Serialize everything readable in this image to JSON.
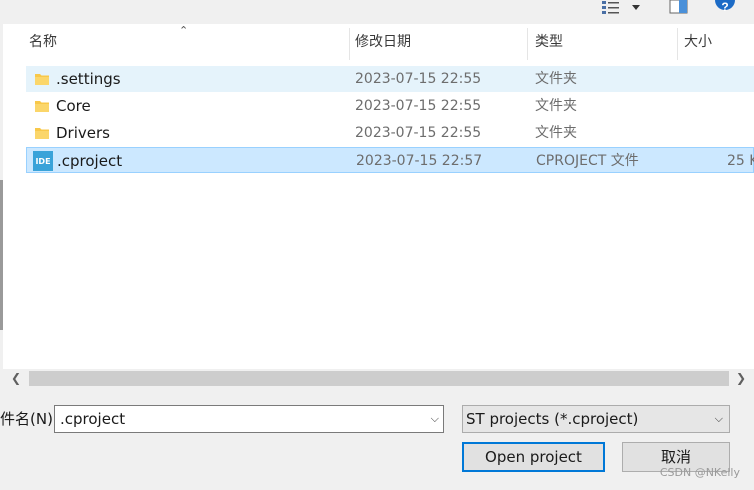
{
  "columns": {
    "name": "名称",
    "date": "修改日期",
    "type": "类型",
    "size": "大小"
  },
  "files": [
    {
      "name": ".settings",
      "date": "2023-07-15 22:55",
      "type": "文件夹",
      "size": "",
      "icon": "folder-icon",
      "state": "hover"
    },
    {
      "name": "Core",
      "date": "2023-07-15 22:55",
      "type": "文件夹",
      "size": "",
      "icon": "folder-icon",
      "state": "normal"
    },
    {
      "name": "Drivers",
      "date": "2023-07-15 22:55",
      "type": "文件夹",
      "size": "",
      "icon": "folder-icon",
      "state": "normal"
    },
    {
      "name": ".cproject",
      "date": "2023-07-15 22:57",
      "type": "CPROJECT 文件",
      "size": "25 K",
      "icon": "ide-file-icon",
      "state": "selected"
    }
  ],
  "ide_icon_text": "IDE",
  "filename": {
    "label": "件名(N):",
    "value": ".cproject"
  },
  "filter": {
    "value": "ST projects (*.cproject)"
  },
  "buttons": {
    "open": "Open project",
    "cancel": "取消"
  },
  "watermark": "CSDN @NKelly",
  "colors": {
    "selected_bg": "#cce8ff",
    "hover_bg": "#e5f3fb",
    "folder": "#f8c84a",
    "ide_icon": "#3aa3d9",
    "default_button_border": "#0078d7"
  }
}
